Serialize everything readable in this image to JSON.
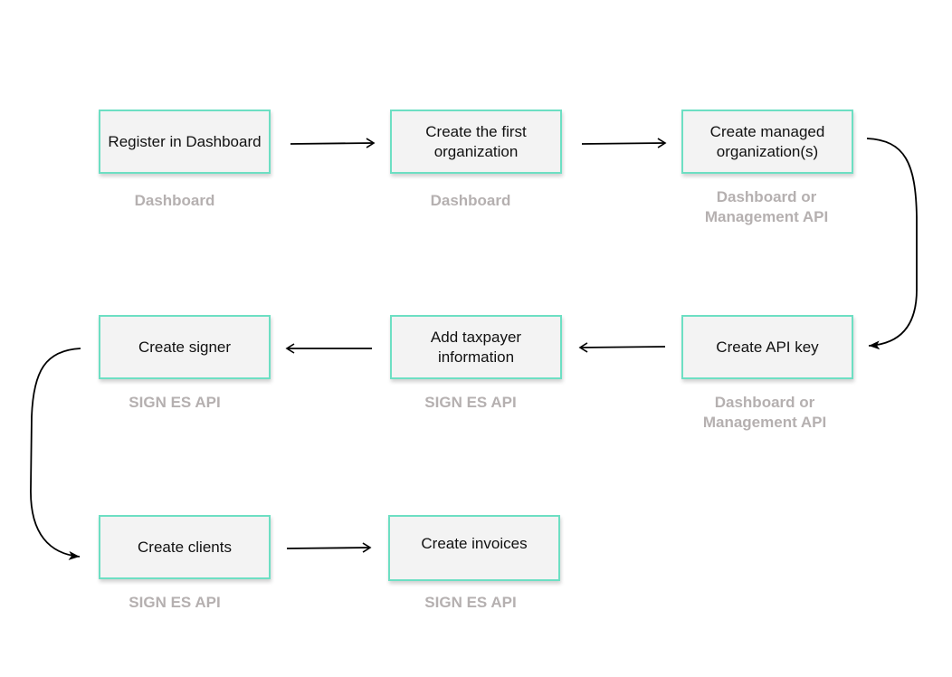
{
  "diagram": {
    "colors": {
      "node_border": "#6ddfc3",
      "node_fill": "#f3f3f3",
      "subtitle": "#b5b0b0",
      "arrow": "#000000"
    },
    "nodes": [
      {
        "id": "register",
        "label": "Register in Dashboard",
        "subtitle": "Dashboard"
      },
      {
        "id": "first-org",
        "label": "Create the first organization",
        "subtitle": "Dashboard"
      },
      {
        "id": "managed-org",
        "label": "Create managed organization(s)",
        "subtitle": "Dashboard or Management API"
      },
      {
        "id": "api-key",
        "label": "Create API key",
        "subtitle": "Dashboard or Management API"
      },
      {
        "id": "taxpayer",
        "label": "Add taxpayer information",
        "subtitle": "SIGN ES API"
      },
      {
        "id": "signer",
        "label": "Create signer",
        "subtitle": "SIGN ES API"
      },
      {
        "id": "clients",
        "label": "Create clients",
        "subtitle": "SIGN ES API"
      },
      {
        "id": "invoices",
        "label": "Create invoices",
        "subtitle": "SIGN ES API"
      }
    ],
    "edges": [
      {
        "from": "register",
        "to": "first-org"
      },
      {
        "from": "first-org",
        "to": "managed-org"
      },
      {
        "from": "managed-org",
        "to": "api-key"
      },
      {
        "from": "api-key",
        "to": "taxpayer"
      },
      {
        "from": "taxpayer",
        "to": "signer"
      },
      {
        "from": "signer",
        "to": "clients"
      },
      {
        "from": "clients",
        "to": "invoices"
      }
    ]
  }
}
